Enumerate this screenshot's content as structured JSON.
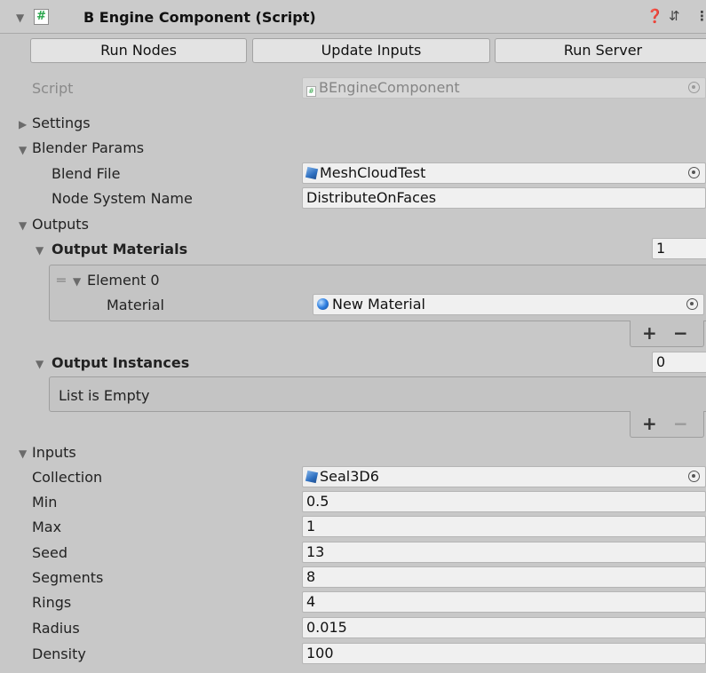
{
  "component": {
    "title": "B Engine Component (Script)",
    "enabled": true,
    "icons": [
      "help-icon",
      "preset-icon",
      "more-icon"
    ]
  },
  "buttons": {
    "run_nodes": "Run Nodes",
    "update_inputs": "Update Inputs",
    "run_server": "Run Server"
  },
  "script": {
    "label": "Script",
    "value": "BEngineComponent"
  },
  "settings": {
    "label": "Settings"
  },
  "blender_params": {
    "label": "Blender Params",
    "blend_file_label": "Blend File",
    "blend_file_value": "MeshCloudTest",
    "node_system_label": "Node System Name",
    "node_system_value": "DistributeOnFaces"
  },
  "outputs": {
    "label": "Outputs",
    "materials": {
      "label": "Output Materials",
      "count": "1",
      "element_label": "Element 0",
      "material_label": "Material",
      "material_value": "New Material"
    },
    "instances": {
      "label": "Output Instances",
      "count": "0",
      "empty_text": "List is Empty"
    },
    "plus": "+",
    "minus": "−"
  },
  "inputs": {
    "label": "Inputs",
    "rows": [
      {
        "label": "Collection",
        "value": "Seal3D6"
      },
      {
        "label": "Min",
        "value": "0.5"
      },
      {
        "label": "Max",
        "value": "1"
      },
      {
        "label": "Seed",
        "value": "13"
      },
      {
        "label": "Segments",
        "value": "8"
      },
      {
        "label": "Rings",
        "value": "4"
      },
      {
        "label": "Radius",
        "value": "0.015"
      },
      {
        "label": "Density",
        "value": "100"
      }
    ]
  },
  "colors": {
    "panel_bg": "#c8c8c8",
    "field_bg": "#f0f0f0",
    "script_accent": "#27a54a"
  }
}
